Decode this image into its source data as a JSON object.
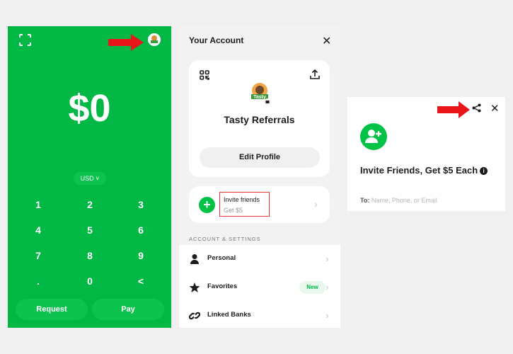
{
  "keypad_screen": {
    "amount": "$0",
    "currency": "USD",
    "keys": [
      "1",
      "2",
      "3",
      "4",
      "5",
      "6",
      "7",
      "8",
      "9",
      ".",
      "0",
      "<"
    ],
    "request_label": "Request",
    "pay_label": "Pay"
  },
  "account_screen": {
    "title": "Your Account",
    "profile_name": "Tasty Referrals",
    "edit_profile_label": "Edit Profile",
    "invite": {
      "title": "Invite friends",
      "subtitle": "Get $5"
    },
    "section_label": "ACCOUNT & SETTINGS",
    "settings": [
      {
        "label": "Personal",
        "icon": "person-icon"
      },
      {
        "label": "Favorites",
        "icon": "star-icon",
        "badge": "New"
      },
      {
        "label": "Linked Banks",
        "icon": "link-icon"
      }
    ]
  },
  "invite_screen": {
    "title": "Invite Friends, Get $5 Each",
    "to_label": "To:",
    "to_placeholder": "Name, Phone, or Email"
  },
  "colors": {
    "brand_green": "#00b843",
    "annotation_red": "#e53935"
  }
}
